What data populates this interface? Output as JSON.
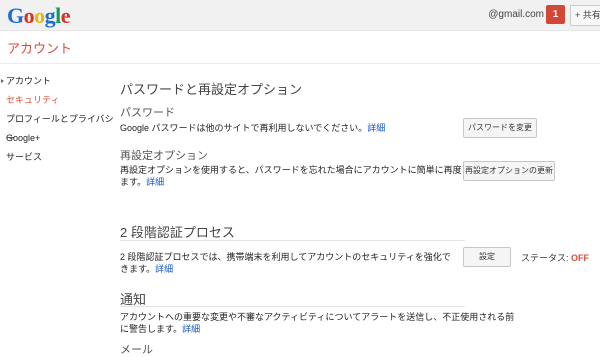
{
  "topbar": {
    "logo_letters": [
      "G",
      "o",
      "o",
      "g",
      "l",
      "e"
    ],
    "email": "@gmail.com",
    "notification_count": "1",
    "share_label": "+ 共有"
  },
  "header": {
    "title": "アカウント"
  },
  "sidebar": {
    "items": [
      {
        "label": "アカウント"
      },
      {
        "label": "セキュリティ"
      },
      {
        "label": "プロフィールとプライバシー"
      },
      {
        "label": "Google+"
      },
      {
        "label": "サービス"
      }
    ]
  },
  "main": {
    "password_section": {
      "title": "パスワードと再設定オプション",
      "password": {
        "heading": "パスワード",
        "desc": "Google パスワードは他のサイトで再利用しないでください。",
        "link": "詳細",
        "button": "パスワードを変更"
      },
      "recovery": {
        "heading": "再設定オプション",
        "desc_line1": "再設定オプションを使用すると、パスワードを忘れた場合にアカウントに簡単に再度アクセスでき",
        "desc_line2": "ます。",
        "link": "詳細",
        "button": "再設定オプションの更新"
      }
    },
    "two_step": {
      "title": "2 段階認証プロセス",
      "desc": "2 段階認証プロセスでは、携帯端末を利用してアカウントのセキュリティを強化できます。",
      "link": "詳細",
      "button": "設定",
      "status_label": "ステータス:",
      "status_value": "OFF"
    },
    "notifications": {
      "title": "通知",
      "desc_line1": "アカウントへの重要な変更や不審なアクティビティについてアラートを送信し、不正使用される前",
      "desc_line2": "に警告します。",
      "link": "詳細",
      "mail_heading": "メール"
    }
  },
  "colors": {
    "accent": "#dd4b39",
    "link": "#1155cc"
  }
}
